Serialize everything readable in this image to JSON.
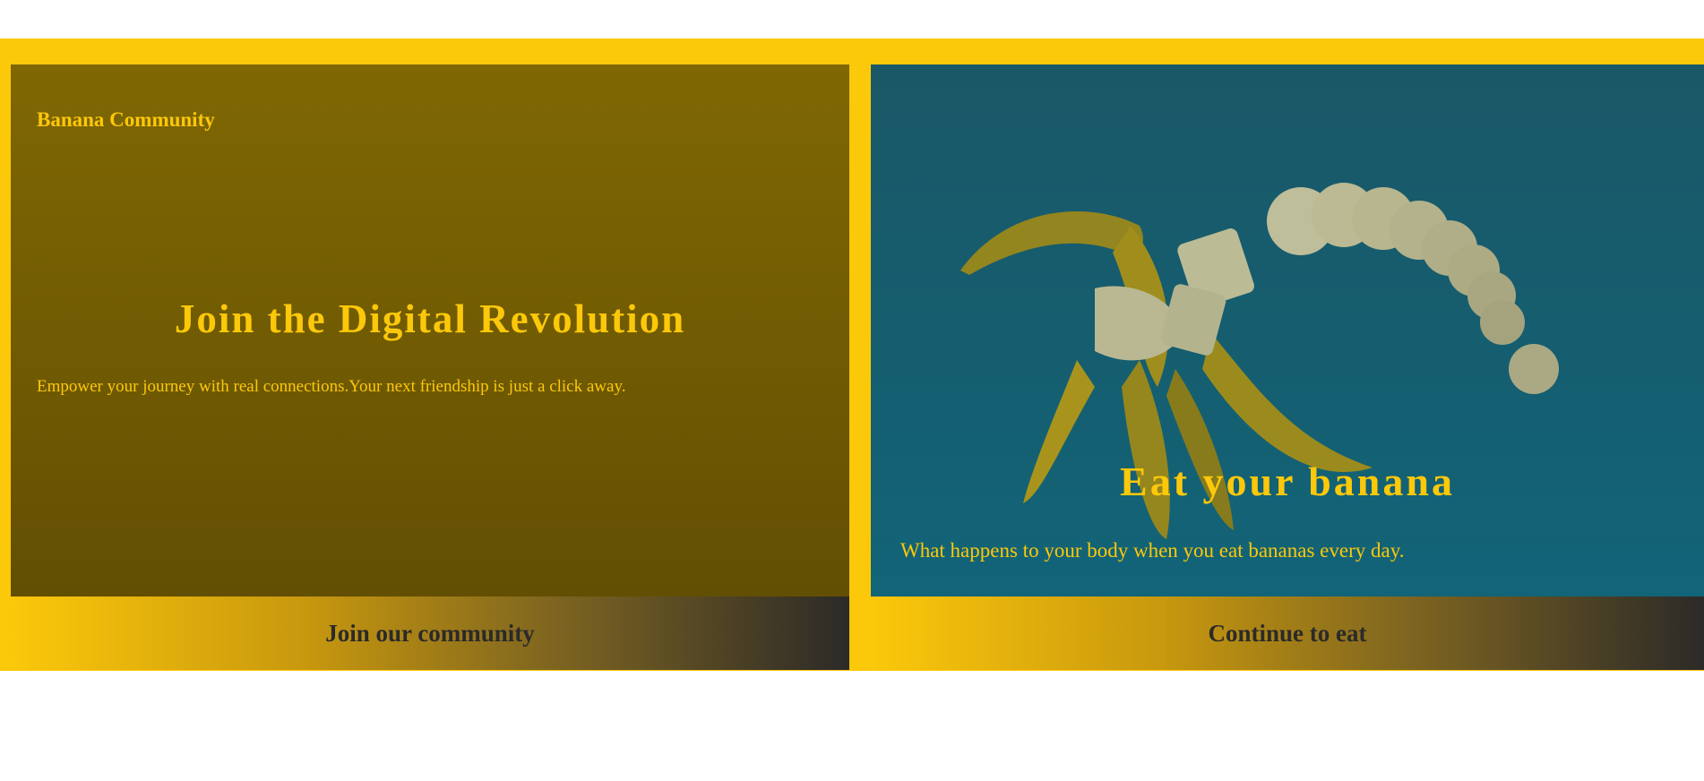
{
  "left_card": {
    "brand": "Banana Community",
    "headline": "Join the Digital Revolution",
    "subtext": "Empower your journey with real connections.Your next friendship is just a click away.",
    "cta_label": "Join our community"
  },
  "right_card": {
    "headline": "Eat your banana",
    "subtext": "What happens to your body when you eat bananas every day.",
    "cta_label": "Continue to eat",
    "image_icon": "peeled-banana-image"
  },
  "colors": {
    "accent": "#fcc80a",
    "dark_text": "#2b2a2a",
    "left_panel": "#735d03",
    "right_panel": "#155e70"
  }
}
